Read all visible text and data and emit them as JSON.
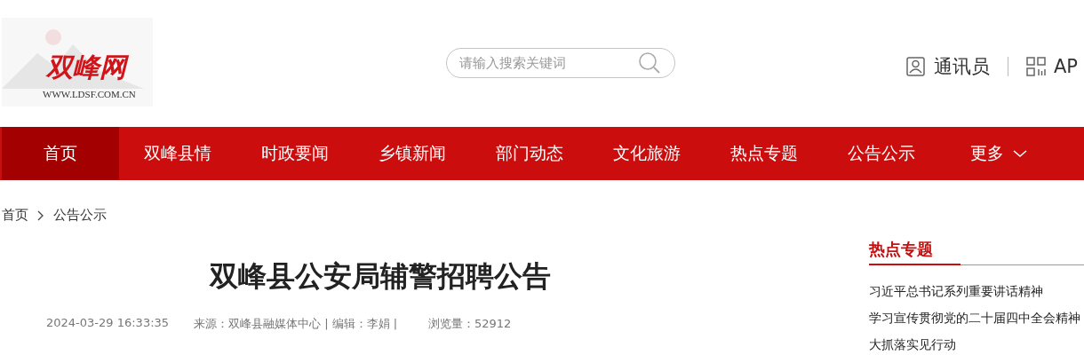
{
  "header": {
    "logo": {
      "name": "双峰网",
      "url": "WWW.LDSF.COM.CN"
    },
    "search": {
      "placeholder": "请输入搜索关键词"
    },
    "links": [
      {
        "kind": "reporter",
        "label": "通讯员"
      },
      {
        "kind": "app",
        "label": "AP"
      }
    ]
  },
  "nav": [
    {
      "label": "首页",
      "selected": true
    },
    {
      "label": "双峰县情",
      "selected": false
    },
    {
      "label": "时政要闻",
      "selected": false
    },
    {
      "label": "乡镇新闻",
      "selected": false
    },
    {
      "label": "部门动态",
      "selected": false
    },
    {
      "label": "文化旅游",
      "selected": false
    },
    {
      "label": "热点专题",
      "selected": false
    },
    {
      "label": "公告公示",
      "selected": false
    },
    {
      "label": "更多",
      "selected": false,
      "dropdown": true
    }
  ],
  "breadcrumb": [
    "首页",
    "公告公示"
  ],
  "article": {
    "title": "双峰县公安局辅警招聘公告",
    "date": "2024-03-29 16:33:35",
    "source": "来源：双峰县融媒体中心 | 编辑：李娟 |",
    "views": "浏览量：52912"
  },
  "sidebar": {
    "title": "热点专题",
    "items": [
      "习近平总书记系列重要讲话精神",
      "学习宣传贯彻党的二十届四中全会精神",
      "大抓落实见行动"
    ]
  }
}
